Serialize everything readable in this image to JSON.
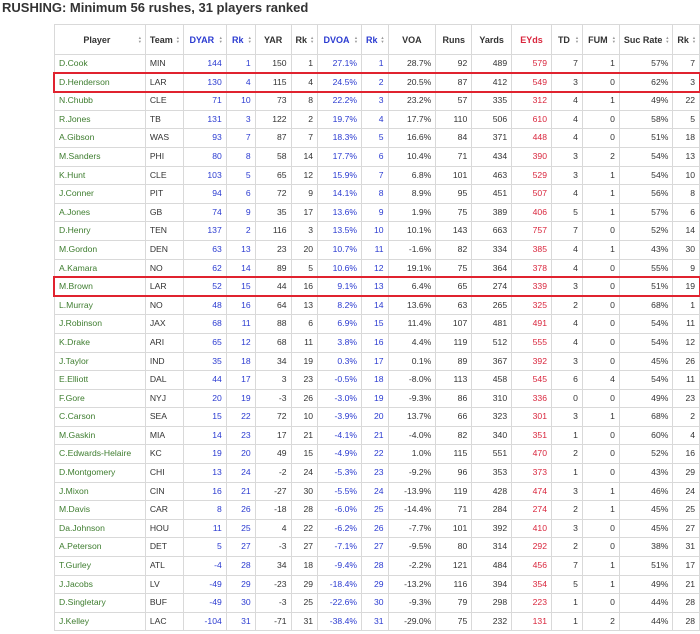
{
  "page": {
    "title": "RUSHING: Minimum 56 rushes, 31 players ranked"
  },
  "colors": {
    "player_green": "#3e7d2f",
    "blue": "#2b3bd1",
    "red": "#d9263d",
    "highlight": "#e0232f"
  },
  "table": {
    "headers": [
      "Player",
      "Team",
      "DYAR",
      "Rk",
      "YAR",
      "Rk",
      "DVOA",
      "Rk",
      "VOA",
      "Runs",
      "Yards",
      "EYds",
      "TD",
      "FUM",
      "Suc Rate",
      "Rk"
    ],
    "header_colors": [
      "",
      "",
      "blue",
      "blue",
      "",
      "",
      "blue",
      "blue",
      "",
      "",
      "",
      "red",
      "",
      "",
      "",
      ""
    ],
    "rows": [
      [
        "D.Cook",
        "MIN",
        "144",
        "1",
        "150",
        "1",
        "27.1%",
        "1",
        "28.7%",
        "92",
        "489",
        "579",
        "7",
        "1",
        "57%",
        "7"
      ],
      [
        "D.Henderson",
        "LAR",
        "130",
        "4",
        "115",
        "4",
        "24.5%",
        "2",
        "20.5%",
        "87",
        "412",
        "549",
        "3",
        "0",
        "62%",
        "3"
      ],
      [
        "N.Chubb",
        "CLE",
        "71",
        "10",
        "73",
        "8",
        "22.2%",
        "3",
        "23.2%",
        "57",
        "335",
        "312",
        "4",
        "1",
        "49%",
        "22"
      ],
      [
        "R.Jones",
        "TB",
        "131",
        "3",
        "122",
        "2",
        "19.7%",
        "4",
        "17.7%",
        "110",
        "506",
        "610",
        "4",
        "0",
        "58%",
        "5"
      ],
      [
        "A.Gibson",
        "WAS",
        "93",
        "7",
        "87",
        "7",
        "18.3%",
        "5",
        "16.6%",
        "84",
        "371",
        "448",
        "4",
        "0",
        "51%",
        "18"
      ],
      [
        "M.Sanders",
        "PHI",
        "80",
        "8",
        "58",
        "14",
        "17.7%",
        "6",
        "10.4%",
        "71",
        "434",
        "390",
        "3",
        "2",
        "54%",
        "13"
      ],
      [
        "K.Hunt",
        "CLE",
        "103",
        "5",
        "65",
        "12",
        "15.9%",
        "7",
        "6.8%",
        "101",
        "463",
        "529",
        "3",
        "1",
        "54%",
        "10"
      ],
      [
        "J.Conner",
        "PIT",
        "94",
        "6",
        "72",
        "9",
        "14.1%",
        "8",
        "8.9%",
        "95",
        "451",
        "507",
        "4",
        "1",
        "56%",
        "8"
      ],
      [
        "A.Jones",
        "GB",
        "74",
        "9",
        "35",
        "17",
        "13.6%",
        "9",
        "1.9%",
        "75",
        "389",
        "406",
        "5",
        "1",
        "57%",
        "6"
      ],
      [
        "D.Henry",
        "TEN",
        "137",
        "2",
        "116",
        "3",
        "13.5%",
        "10",
        "10.1%",
        "143",
        "663",
        "757",
        "7",
        "0",
        "52%",
        "14"
      ],
      [
        "M.Gordon",
        "DEN",
        "63",
        "13",
        "23",
        "20",
        "10.7%",
        "11",
        "-1.6%",
        "82",
        "334",
        "385",
        "4",
        "1",
        "43%",
        "30"
      ],
      [
        "A.Kamara",
        "NO",
        "62",
        "14",
        "89",
        "5",
        "10.6%",
        "12",
        "19.1%",
        "75",
        "364",
        "378",
        "4",
        "0",
        "55%",
        "9"
      ],
      [
        "M.Brown",
        "LAR",
        "52",
        "15",
        "44",
        "16",
        "9.1%",
        "13",
        "6.4%",
        "65",
        "274",
        "339",
        "3",
        "0",
        "51%",
        "19"
      ],
      [
        "L.Murray",
        "NO",
        "48",
        "16",
        "64",
        "13",
        "8.2%",
        "14",
        "13.6%",
        "63",
        "265",
        "325",
        "2",
        "0",
        "68%",
        "1"
      ],
      [
        "J.Robinson",
        "JAX",
        "68",
        "11",
        "88",
        "6",
        "6.9%",
        "15",
        "11.4%",
        "107",
        "481",
        "491",
        "4",
        "0",
        "54%",
        "11"
      ],
      [
        "K.Drake",
        "ARI",
        "65",
        "12",
        "68",
        "11",
        "3.8%",
        "16",
        "4.4%",
        "119",
        "512",
        "555",
        "4",
        "0",
        "54%",
        "12"
      ],
      [
        "J.Taylor",
        "IND",
        "35",
        "18",
        "34",
        "19",
        "0.3%",
        "17",
        "0.1%",
        "89",
        "367",
        "392",
        "3",
        "0",
        "45%",
        "26"
      ],
      [
        "E.Elliott",
        "DAL",
        "44",
        "17",
        "3",
        "23",
        "-0.5%",
        "18",
        "-8.0%",
        "113",
        "458",
        "545",
        "6",
        "4",
        "54%",
        "11"
      ],
      [
        "F.Gore",
        "NYJ",
        "20",
        "19",
        "-3",
        "26",
        "-3.0%",
        "19",
        "-9.3%",
        "86",
        "310",
        "336",
        "0",
        "0",
        "49%",
        "23"
      ],
      [
        "C.Carson",
        "SEA",
        "15",
        "22",
        "72",
        "10",
        "-3.9%",
        "20",
        "13.7%",
        "66",
        "323",
        "301",
        "3",
        "1",
        "68%",
        "2"
      ],
      [
        "M.Gaskin",
        "MIA",
        "14",
        "23",
        "17",
        "21",
        "-4.1%",
        "21",
        "-4.0%",
        "82",
        "340",
        "351",
        "1",
        "0",
        "60%",
        "4"
      ],
      [
        "C.Edwards-Helaire",
        "KC",
        "19",
        "20",
        "49",
        "15",
        "-4.9%",
        "22",
        "1.0%",
        "115",
        "551",
        "470",
        "2",
        "0",
        "52%",
        "16"
      ],
      [
        "D.Montgomery",
        "CHI",
        "13",
        "24",
        "-2",
        "24",
        "-5.3%",
        "23",
        "-9.2%",
        "96",
        "353",
        "373",
        "1",
        "0",
        "43%",
        "29"
      ],
      [
        "J.Mixon",
        "CIN",
        "16",
        "21",
        "-27",
        "30",
        "-5.5%",
        "24",
        "-13.9%",
        "119",
        "428",
        "474",
        "3",
        "1",
        "46%",
        "24"
      ],
      [
        "M.Davis",
        "CAR",
        "8",
        "26",
        "-18",
        "28",
        "-6.0%",
        "25",
        "-14.4%",
        "71",
        "284",
        "274",
        "2",
        "1",
        "45%",
        "25"
      ],
      [
        "Da.Johnson",
        "HOU",
        "11",
        "25",
        "4",
        "22",
        "-6.2%",
        "26",
        "-7.7%",
        "101",
        "392",
        "410",
        "3",
        "0",
        "45%",
        "27"
      ],
      [
        "A.Peterson",
        "DET",
        "5",
        "27",
        "-3",
        "27",
        "-7.1%",
        "27",
        "-9.5%",
        "80",
        "314",
        "292",
        "2",
        "0",
        "38%",
        "31"
      ],
      [
        "T.Gurley",
        "ATL",
        "-4",
        "28",
        "34",
        "18",
        "-9.4%",
        "28",
        "-2.2%",
        "121",
        "484",
        "456",
        "7",
        "1",
        "51%",
        "17"
      ],
      [
        "J.Jacobs",
        "LV",
        "-49",
        "29",
        "-23",
        "29",
        "-18.4%",
        "29",
        "-13.2%",
        "116",
        "394",
        "354",
        "5",
        "1",
        "49%",
        "21"
      ],
      [
        "D.Singletary",
        "BUF",
        "-49",
        "30",
        "-3",
        "25",
        "-22.6%",
        "30",
        "-9.3%",
        "79",
        "298",
        "223",
        "1",
        "0",
        "44%",
        "28"
      ],
      [
        "J.Kelley",
        "LAC",
        "-104",
        "31",
        "-71",
        "31",
        "-38.4%",
        "31",
        "-29.0%",
        "75",
        "232",
        "131",
        "1",
        "2",
        "44%",
        "28"
      ]
    ],
    "highlighted_players": [
      "D.Henderson",
      "M.Brown"
    ]
  }
}
